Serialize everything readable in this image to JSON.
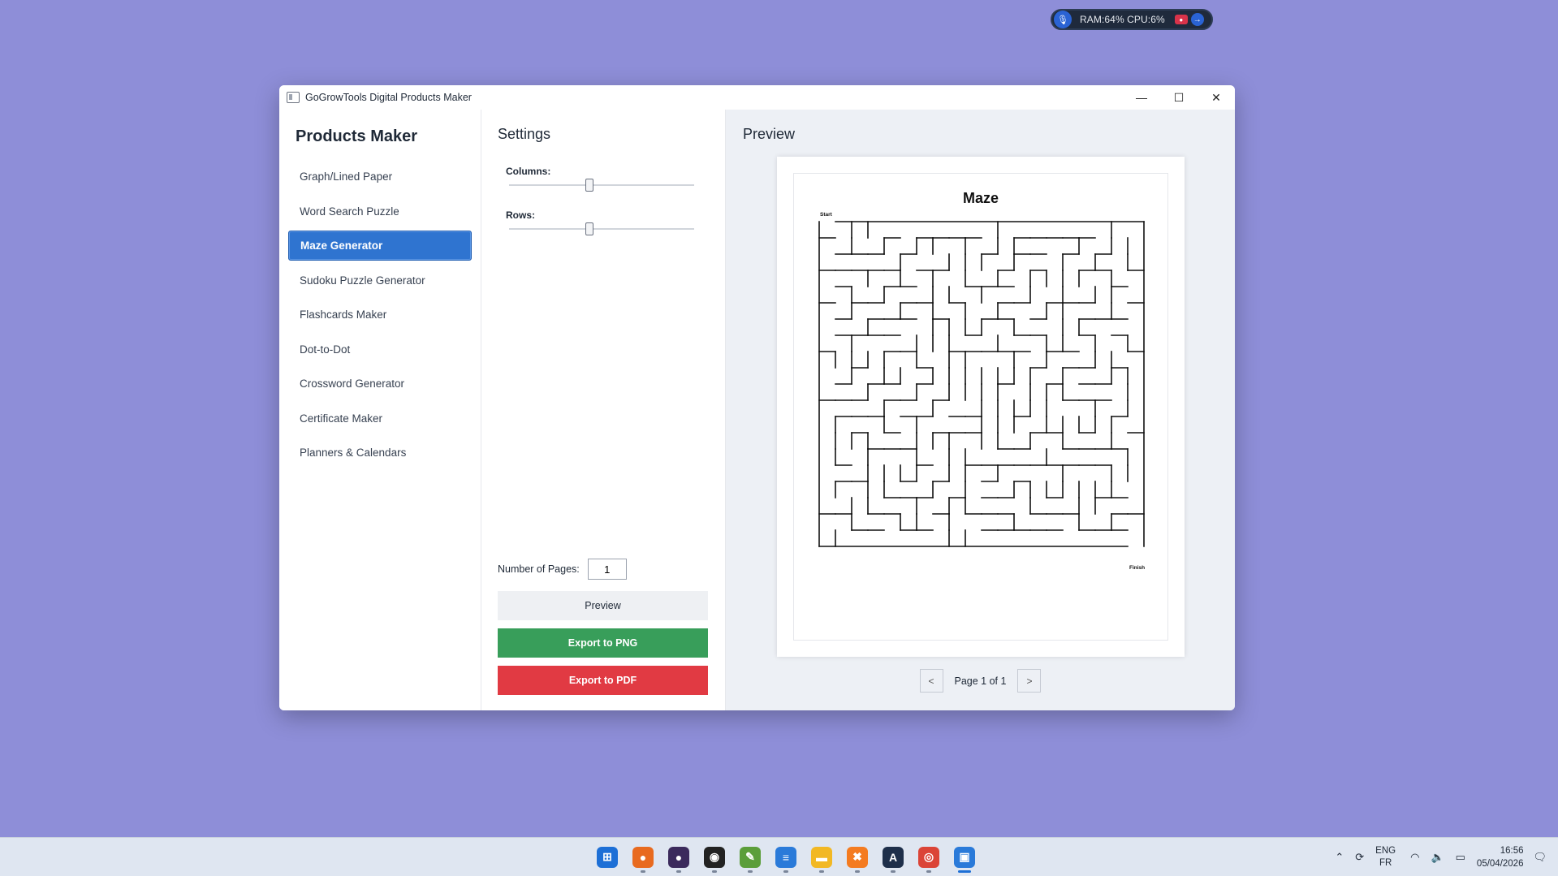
{
  "system_widget": {
    "ram_cpu": "RAM:64%  CPU:6%"
  },
  "window": {
    "title": "GoGrowTools Digital Products Maker",
    "minimize": "—",
    "maximize": "☐",
    "close": "✕"
  },
  "sidebar": {
    "heading": "Products Maker",
    "items": [
      {
        "label": "Graph/Lined Paper"
      },
      {
        "label": "Word Search Puzzle"
      },
      {
        "label": "Maze Generator"
      },
      {
        "label": "Sudoku Puzzle Generator"
      },
      {
        "label": "Flashcards Maker"
      },
      {
        "label": "Dot-to-Dot"
      },
      {
        "label": "Crossword Generator"
      },
      {
        "label": "Certificate Maker"
      },
      {
        "label": "Planners & Calendars"
      }
    ],
    "active_index": 2
  },
  "settings": {
    "heading": "Settings",
    "columns_label": "Columns:",
    "columns_level": 0.43,
    "rows_label": "Rows:",
    "rows_level": 0.43,
    "pages_label": "Number of Pages:",
    "pages_value": "1",
    "preview_button": "Preview",
    "export_png_button": "Export to PNG",
    "export_pdf_button": "Export to PDF",
    "png_color": "#389e5a",
    "pdf_color": "#e13a43"
  },
  "preview": {
    "heading": "Preview",
    "maze_title": "Maze",
    "start_label": "Start",
    "finish_label": "Finish",
    "page_text": "Page 1 of 1",
    "prev": "<",
    "next": ">"
  },
  "taskbar": {
    "apps": [
      {
        "name": "start-icon",
        "glyph": "⊞",
        "color": "#1d6fd6"
      },
      {
        "name": "firefox-icon",
        "glyph": "●",
        "color": "#e86a1f"
      },
      {
        "name": "app-purple-icon",
        "glyph": "●",
        "color": "#3b2a5c"
      },
      {
        "name": "obs-icon",
        "glyph": "◉",
        "color": "#222"
      },
      {
        "name": "notepad-green-icon",
        "glyph": "✎",
        "color": "#5b9e3a"
      },
      {
        "name": "notepad-icon",
        "glyph": "≡",
        "color": "#2a7ad9"
      },
      {
        "name": "file-explorer-icon",
        "glyph": "▬",
        "color": "#f2b824"
      },
      {
        "name": "xampp-icon",
        "glyph": "✖",
        "color": "#f47b20"
      },
      {
        "name": "editor-a-icon",
        "glyph": "A",
        "color": "#1e2f4a"
      },
      {
        "name": "chrome-icon",
        "glyph": "◎",
        "color": "#db4437"
      },
      {
        "name": "active-app-icon",
        "glyph": "▣",
        "color": "#2a7ad9"
      }
    ],
    "lang_top": "ENG",
    "lang_bottom": "FR",
    "time": "16:56",
    "date": "05/04/2026"
  }
}
